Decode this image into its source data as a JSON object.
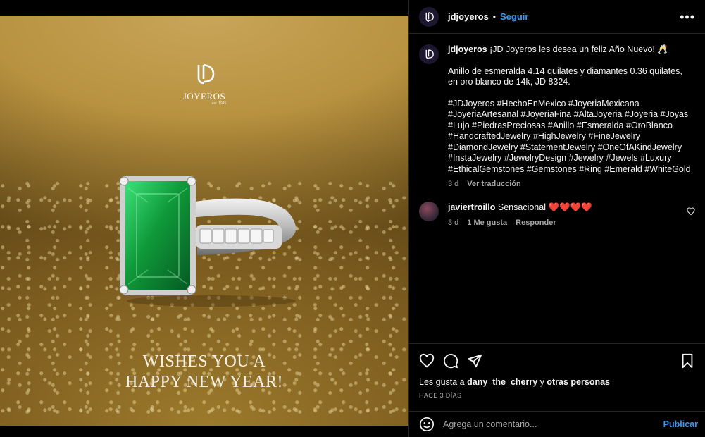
{
  "post_image": {
    "brand_name": "JOYEROS",
    "brand_sub": "est. 1945",
    "wish_line1": "WISHES YOU A",
    "wish_line2": "HAPPY NEW YEAR!"
  },
  "header": {
    "username": "jdjoyeros",
    "separator": "•",
    "follow_label": "Seguir",
    "more_label": "•••"
  },
  "caption": {
    "username": "jdjoyeros",
    "greeting": "¡JD Joyeros les desea un feliz Año Nuevo! 🥂",
    "description": "Anillo de esmeralda 4.14 quilates y diamantes 0.36 quilates, en oro blanco de 14k, JD 8324.",
    "hashtags": "#JDJoyeros #HechoEnMexico #JoyeriaMexicana #JoyeriaArtesanal #JoyeriaFina #AltaJoyeria #Joyeria #Joyas #Lujo #PiedrasPreciosas #Anillo #Esmeralda #OroBlanco #HandcraftedJewelry #HighJewelry #FineJewelry #DiamondJewelry #StatementJewelry #OneOfAKindJewelry #InstaJewelry #JewelryDesign #Jewelry #Jewels #Luxury #EthicalGemstones #Gemstones #Ring #Emerald #WhiteGold",
    "time": "3 d",
    "see_translation": "Ver traducción"
  },
  "comments": [
    {
      "username": "javiertroillo",
      "text": "Sensacional ❤️❤️❤️❤️",
      "time": "3 d",
      "likes": "1 Me gusta",
      "reply": "Responder"
    }
  ],
  "actions": {
    "likes_prefix": "Les gusta a ",
    "likes_user": "dany_the_cherry",
    "likes_suffix": " y ",
    "likes_others": "otras personas",
    "time_ago": "HACE 3 DÍAS"
  },
  "comment_box": {
    "placeholder": "Agrega un comentario...",
    "publish_label": "Publicar"
  },
  "colors": {
    "accent": "#3897f0",
    "emerald": "#0f9a3a",
    "gold": "#b8923f"
  }
}
